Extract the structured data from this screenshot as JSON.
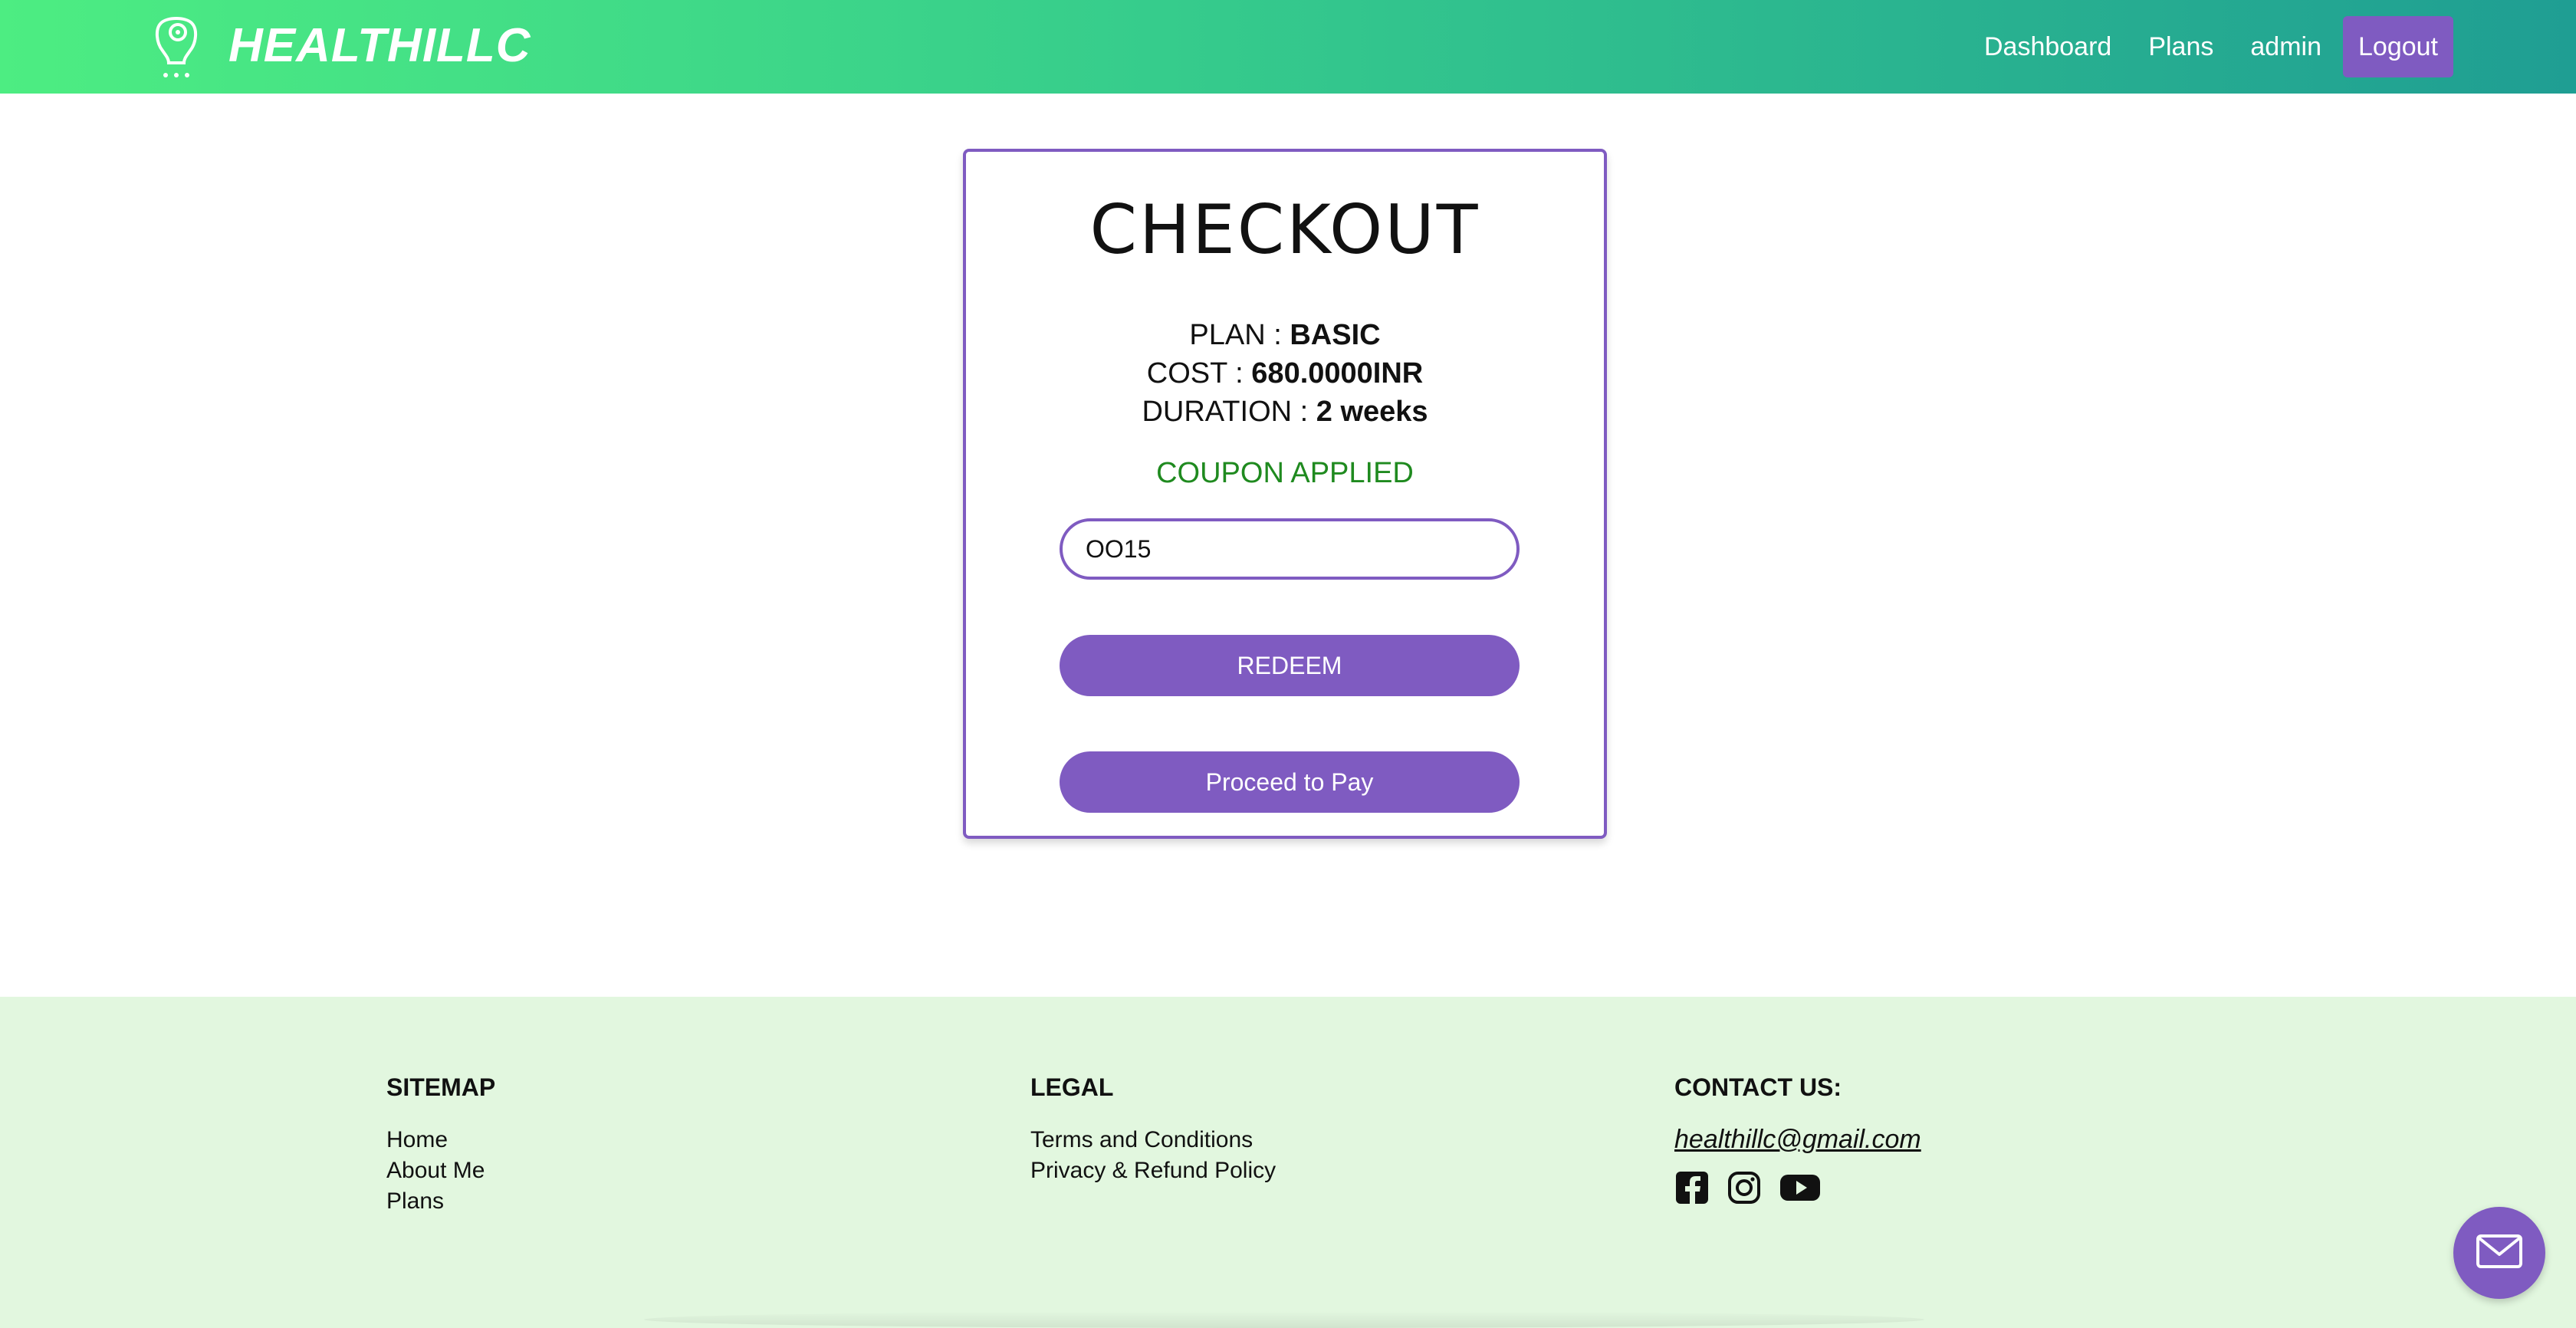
{
  "header": {
    "brand": "HEALTHILLC",
    "nav": {
      "dashboard": "Dashboard",
      "plans": "Plans",
      "user": "admin",
      "logout": "Logout"
    }
  },
  "checkout": {
    "title": "CHECKOUT",
    "plan_label": "PLAN : ",
    "plan_value": "BASIC",
    "cost_label": "COST : ",
    "cost_value": "680.0000INR",
    "duration_label": "DURATION : ",
    "duration_value": "2 weeks",
    "coupon_status": "COUPON APPLIED",
    "coupon_code": "OO15",
    "redeem_label": "REDEEM",
    "pay_label": "Proceed to Pay"
  },
  "footer": {
    "sitemap": {
      "heading": "SITEMAP",
      "links": [
        "Home",
        "About Me",
        "Plans"
      ]
    },
    "legal": {
      "heading": "LEGAL",
      "links": [
        "Terms and Conditions",
        "Privacy & Refund Policy"
      ]
    },
    "contact": {
      "heading": "CONTACT US:",
      "email": "healthillc@gmail.com",
      "social_icons": [
        "facebook-icon",
        "instagram-icon",
        "youtube-icon"
      ]
    }
  },
  "colors": {
    "header_gradient_start": "#4ded82",
    "header_gradient_end": "#1f9e93",
    "accent_purple": "#7f5bc1",
    "coupon_green": "#1f8a1f",
    "footer_bg": "#e2f7df"
  }
}
